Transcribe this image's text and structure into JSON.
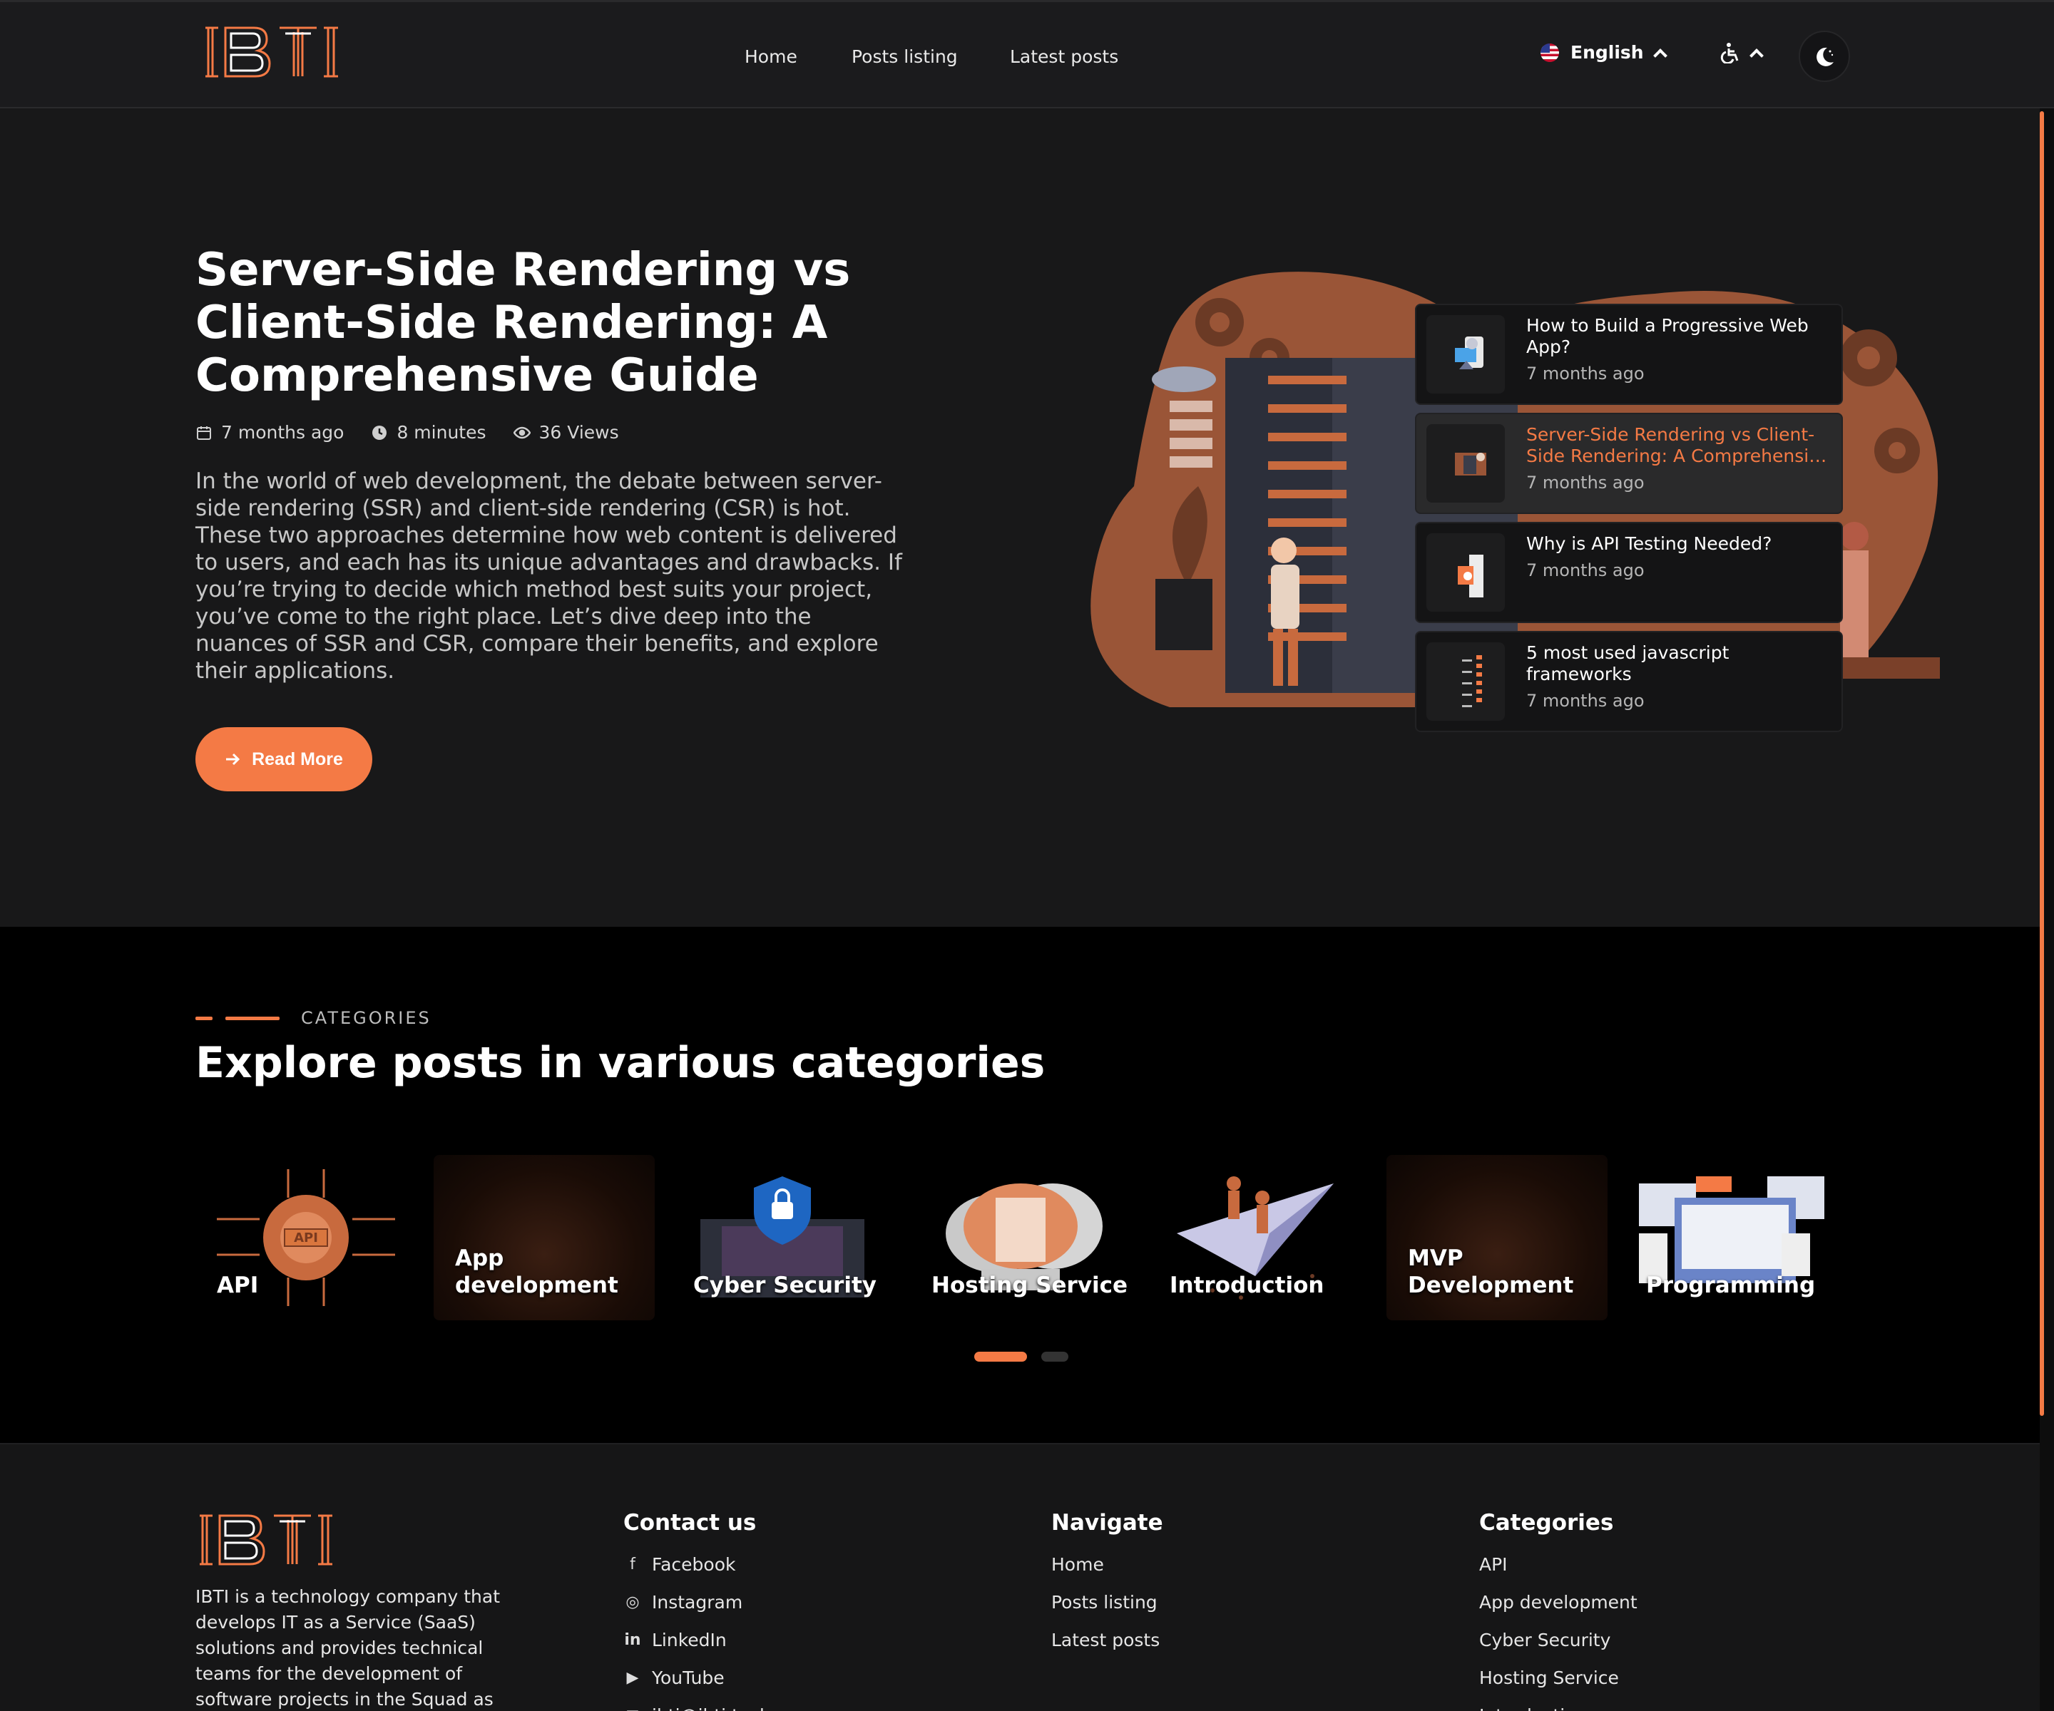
{
  "brand": {
    "logo_text": "IBTI"
  },
  "nav": {
    "home": "Home",
    "posts_listing": "Posts listing",
    "latest_posts": "Latest posts"
  },
  "header": {
    "language": "English",
    "a11y_icon": "accessibility-icon",
    "theme_icon": "moon-icon"
  },
  "hero": {
    "title": "Server-Side Rendering vs Client-Side Rendering: A Comprehensive Guide",
    "date": "7 months ago",
    "read_time": "8 minutes",
    "views": "36 Views",
    "description": "In the world of web development, the debate between server-side rendering (SSR) and client-side rendering (CSR) is hot. These two approaches determine how web content is delivered to users, and each has its unique advantages and drawbacks. If you’re trying to decide which method best suits your project, you’ve come to the right place. Let’s dive deep into the nuances of SSR and CSR, compare their benefits, and explore their applications.",
    "read_more": "Read More"
  },
  "recent_posts": [
    {
      "title": "How to Build a Progressive Web App?",
      "time": "7 months ago",
      "active": false
    },
    {
      "title": "Server-Side Rendering vs Client-Side Rendering: A Comprehensive Guide",
      "time": "7 months ago",
      "active": true
    },
    {
      "title": "Why is API Testing Needed?",
      "time": "7 months ago",
      "active": false
    },
    {
      "title": "5 most used javascript frameworks",
      "time": "7 months ago",
      "active": false
    }
  ],
  "categories": {
    "eyebrow": "CATEGORIES",
    "title": "Explore posts in various categories",
    "items": [
      {
        "label": "API"
      },
      {
        "label": "App development"
      },
      {
        "label": "Cyber Security"
      },
      {
        "label": "Hosting Service"
      },
      {
        "label": "Introduction"
      },
      {
        "label": "MVP Development"
      },
      {
        "label": "Programming"
      }
    ],
    "page_count": 2,
    "current_page": 1
  },
  "footer": {
    "about": "IBTI is a technology company that develops IT as a Service (SaaS) solutions and provides technical teams for the development of software projects in the Squad as",
    "contact": {
      "heading": "Contact us",
      "items": [
        {
          "label": "Facebook",
          "icon": "facebook-icon"
        },
        {
          "label": "Instagram",
          "icon": "instagram-icon"
        },
        {
          "label": "LinkedIn",
          "icon": "linkedin-icon"
        },
        {
          "label": "YouTube",
          "icon": "youtube-icon"
        },
        {
          "label": "ibti@ibti.tech",
          "icon": "mail-icon"
        }
      ]
    },
    "navigate": {
      "heading": "Navigate",
      "items": [
        "Home",
        "Posts listing",
        "Latest posts"
      ]
    },
    "categories": {
      "heading": "Categories",
      "items": [
        "API",
        "App development",
        "Cyber Security",
        "Hosting Service",
        "Introduction"
      ]
    }
  },
  "colors": {
    "accent": "#f47a45",
    "hero_bg": "#181819",
    "section_bg": "#000000",
    "footer_bg": "#161617"
  }
}
